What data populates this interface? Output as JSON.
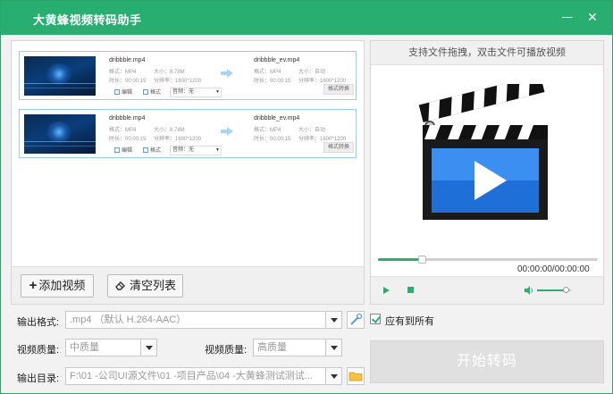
{
  "window": {
    "title": "大黄蜂视频转码助手"
  },
  "files": [
    {
      "src_name": "dribbble.mp4",
      "src_format": "格式：MP4",
      "src_size": "大小：8.78M",
      "src_duration": "时长：00:00:15",
      "src_resolution": "分辨率：1600*1200",
      "dst_name": "dribbble_ev.mp4",
      "dst_format": "格式：MP4",
      "dst_size": "大小：自动",
      "dst_duration": "时长：00:00:15",
      "dst_resolution": "分辨率：1600*1200",
      "edit_label": "编辑",
      "format_label": "格式",
      "subtitle_label": "音频：无",
      "convert_label": "格式转换"
    },
    {
      "src_name": "dribbble.mp4",
      "src_format": "格式：MP4",
      "src_size": "大小：8.78M",
      "src_duration": "时长：00:00:15",
      "src_resolution": "分辨率：1600*1200",
      "dst_name": "dribbble_ev.mp4",
      "dst_format": "格式：MP4",
      "dst_size": "大小：自动",
      "dst_duration": "时长：00:00:15",
      "dst_resolution": "分辨率：1600*1200",
      "edit_label": "编辑",
      "format_label": "格式",
      "subtitle_label": "音频：无",
      "convert_label": "格式转换"
    }
  ],
  "left_toolbar": {
    "add_label": "添加视频",
    "clear_label": "清空列表"
  },
  "preview": {
    "hint": "支持文件拖拽，双击文件可播放视频",
    "time": "00:00:00/00:00:00",
    "progress": 0.2,
    "volume": 0.85
  },
  "settings": {
    "output_format_label": "输出格式:",
    "output_format_value": ".mp4 （默认 H.264-AAC）",
    "apply_all_label": "应有到所有",
    "video_quality_label": "视频质量:",
    "video_quality_value": "中质量",
    "video_quality2_label": "视频质量:",
    "video_quality2_value": "高质量",
    "output_dir_label": "输出目录:",
    "output_dir_value": "F:\\01 -公司UI源文件\\01 -项目产品\\04 -大黄蜂测试测试...",
    "start_label": "开始转码"
  },
  "colors": {
    "accent": "#27ae70",
    "card_border": "#9ccbe8"
  }
}
